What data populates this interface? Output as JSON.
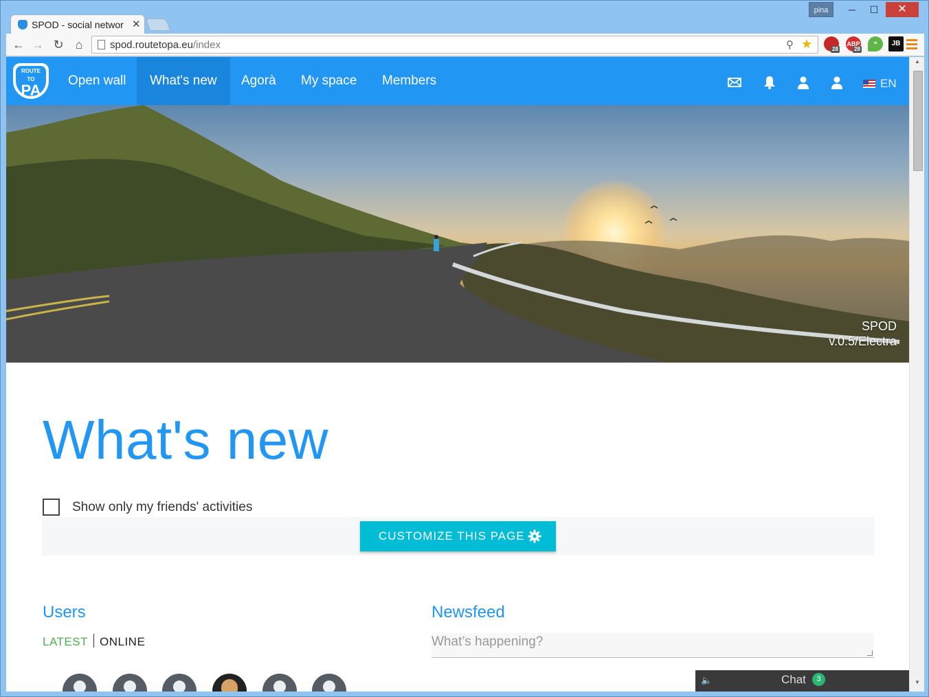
{
  "window": {
    "profile": "pina",
    "tab_title": "SPOD - social networ",
    "url_host": "spod.routetopa.eu",
    "url_path": "/index",
    "extensions": [
      {
        "name": "lastpass-extension",
        "label": "",
        "badge": "28"
      },
      {
        "name": "adblock-plus-extension",
        "label": "ABP",
        "badge": "28"
      },
      {
        "name": "hangouts-extension",
        "label": "❝"
      },
      {
        "name": "jetbrains-extension",
        "label": "JB"
      }
    ]
  },
  "navbar": {
    "logo": {
      "top": "ROUTE",
      "middle": "TO",
      "main": "PA"
    },
    "items": [
      {
        "label": "Open wall"
      },
      {
        "label": "What's new",
        "active": true
      },
      {
        "label": "Agorà"
      },
      {
        "label": "My space"
      },
      {
        "label": "Members"
      }
    ],
    "icons": [
      "mail-icon",
      "bell-icon",
      "user-icon",
      "user-icon"
    ],
    "language": "EN"
  },
  "hero": {
    "line1": "SPOD",
    "line2": "v.0.5/Electra"
  },
  "main": {
    "title": "What's new",
    "filter_label": "Show only my friends' activities",
    "filter_checked": false,
    "customize_label": "CUSTOMIZE THIS PAGE"
  },
  "users": {
    "heading": "Users",
    "tab_latest": "LATEST",
    "tab_online": "ONLINE",
    "active_tab": "LATEST",
    "avatars": [
      "default",
      "default",
      "default",
      "photo",
      "default",
      "default"
    ]
  },
  "newsfeed": {
    "heading": "Newsfeed",
    "placeholder": "What’s happening?"
  },
  "chat": {
    "label": "Chat",
    "count": "3"
  },
  "colors": {
    "brand": "#2196f3",
    "nav_active": "#1a85dc",
    "customize_button": "#00bcd4",
    "latest_tab": "#4caf50",
    "chat_badge": "#2bb673"
  }
}
